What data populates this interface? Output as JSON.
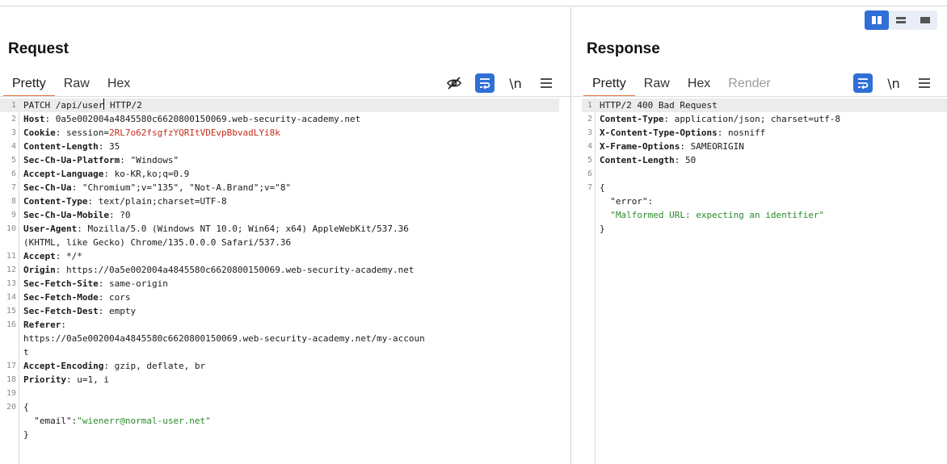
{
  "layout_toggle": {
    "icons": [
      "split-vertical-icon",
      "split-horizontal-icon",
      "single-pane-icon"
    ],
    "active": 0,
    "accent": "#2f6fd6"
  },
  "request": {
    "title": "Request",
    "tabs": [
      {
        "label": "Pretty",
        "active": true
      },
      {
        "label": "Raw",
        "active": false
      },
      {
        "label": "Hex",
        "active": false
      }
    ],
    "toolbar": {
      "hide_icon": "eye-off-icon",
      "wrap_icon": "word-wrap-icon",
      "newline_label": "\\n",
      "menu_icon": "hamburger-menu-icon"
    },
    "lines": [
      {
        "n": "1",
        "parts": [
          {
            "t": "PATCH /api/user",
            "c": "hv"
          },
          {
            "t": "CARET"
          },
          {
            "t": " HTTP/2",
            "c": "hv"
          }
        ],
        "cur": true
      },
      {
        "n": "2",
        "parts": [
          {
            "t": "Host",
            "c": "hk"
          },
          {
            "t": ": 0a5e002004a4845580c6620800150069.web-security-academy.net",
            "c": "hv"
          }
        ]
      },
      {
        "n": "3",
        "parts": [
          {
            "t": "Cookie",
            "c": "hk"
          },
          {
            "t": ": session=",
            "c": "hv"
          },
          {
            "t": "2RL7o62fsgfzYQRItVDEvpBbvadLYi8k",
            "c": "cookie-val"
          }
        ]
      },
      {
        "n": "4",
        "parts": [
          {
            "t": "Content-Length",
            "c": "hk"
          },
          {
            "t": ": 35",
            "c": "hv"
          }
        ]
      },
      {
        "n": "5",
        "parts": [
          {
            "t": "Sec-Ch-Ua-Platform",
            "c": "hk"
          },
          {
            "t": ": \"Windows\"",
            "c": "hv"
          }
        ]
      },
      {
        "n": "6",
        "parts": [
          {
            "t": "Accept-Language",
            "c": "hk"
          },
          {
            "t": ": ko-KR,ko;q=0.9",
            "c": "hv"
          }
        ]
      },
      {
        "n": "7",
        "parts": [
          {
            "t": "Sec-Ch-Ua",
            "c": "hk"
          },
          {
            "t": ": \"Chromium\";v=\"135\", \"Not-A.Brand\";v=\"8\"",
            "c": "hv"
          }
        ]
      },
      {
        "n": "8",
        "parts": [
          {
            "t": "Content-Type",
            "c": "hk"
          },
          {
            "t": ": text/plain;charset=UTF-8",
            "c": "hv"
          }
        ]
      },
      {
        "n": "9",
        "parts": [
          {
            "t": "Sec-Ch-Ua-Mobile",
            "c": "hk"
          },
          {
            "t": ": ?0",
            "c": "hv"
          }
        ]
      },
      {
        "n": "10",
        "parts": [
          {
            "t": "User-Agent",
            "c": "hk"
          },
          {
            "t": ": Mozilla/5.0 (Windows NT 10.0; Win64; x64) AppleWebKit/537.36",
            "c": "hv"
          }
        ]
      },
      {
        "n": "",
        "parts": [
          {
            "t": "(KHTML, like Gecko) Chrome/135.0.0.0 Safari/537.36",
            "c": "hv"
          }
        ]
      },
      {
        "n": "11",
        "parts": [
          {
            "t": "Accept",
            "c": "hk"
          },
          {
            "t": ": */*",
            "c": "hv"
          }
        ]
      },
      {
        "n": "12",
        "parts": [
          {
            "t": "Origin",
            "c": "hk"
          },
          {
            "t": ": https://0a5e002004a4845580c6620800150069.web-security-academy.net",
            "c": "hv"
          }
        ]
      },
      {
        "n": "13",
        "parts": [
          {
            "t": "Sec-Fetch-Site",
            "c": "hk"
          },
          {
            "t": ": same-origin",
            "c": "hv"
          }
        ]
      },
      {
        "n": "14",
        "parts": [
          {
            "t": "Sec-Fetch-Mode",
            "c": "hk"
          },
          {
            "t": ": cors",
            "c": "hv"
          }
        ]
      },
      {
        "n": "15",
        "parts": [
          {
            "t": "Sec-Fetch-Dest",
            "c": "hk"
          },
          {
            "t": ": empty",
            "c": "hv"
          }
        ]
      },
      {
        "n": "16",
        "parts": [
          {
            "t": "Referer",
            "c": "hk"
          },
          {
            "t": ":",
            "c": "hv"
          }
        ]
      },
      {
        "n": "",
        "parts": [
          {
            "t": "https://0a5e002004a4845580c6620800150069.web-security-academy.net/my-accoun",
            "c": "hv"
          }
        ]
      },
      {
        "n": "",
        "parts": [
          {
            "t": "t",
            "c": "hv"
          }
        ]
      },
      {
        "n": "17",
        "parts": [
          {
            "t": "Accept-Encoding",
            "c": "hk"
          },
          {
            "t": ": gzip, deflate, br",
            "c": "hv"
          }
        ]
      },
      {
        "n": "18",
        "parts": [
          {
            "t": "Priority",
            "c": "hk"
          },
          {
            "t": ": u=1, i",
            "c": "hv"
          }
        ]
      },
      {
        "n": "19",
        "parts": [
          {
            "t": "",
            "c": "hv"
          }
        ]
      },
      {
        "n": "20",
        "parts": [
          {
            "t": "{",
            "c": "hv"
          }
        ]
      },
      {
        "n": "",
        "parts": [
          {
            "t": "  \"email\"",
            "c": "jk"
          },
          {
            "t": ":",
            "c": "hv"
          },
          {
            "t": "\"wienerr@normal-user.net\"",
            "c": "js"
          }
        ]
      },
      {
        "n": "",
        "parts": [
          {
            "t": "}",
            "c": "hv"
          }
        ]
      }
    ]
  },
  "response": {
    "title": "Response",
    "tabs": [
      {
        "label": "Pretty",
        "active": true
      },
      {
        "label": "Raw",
        "active": false
      },
      {
        "label": "Hex",
        "active": false
      },
      {
        "label": "Render",
        "active": false,
        "disabled": true
      }
    ],
    "toolbar": {
      "wrap_icon": "word-wrap-icon",
      "newline_label": "\\n",
      "menu_icon": "hamburger-menu-icon"
    },
    "lines": [
      {
        "n": "1",
        "parts": [
          {
            "t": "HTTP/2 400 Bad Request",
            "c": "hv"
          }
        ],
        "cur": true
      },
      {
        "n": "2",
        "parts": [
          {
            "t": "Content-Type",
            "c": "hk"
          },
          {
            "t": ": application/json; charset=utf-8",
            "c": "hv"
          }
        ]
      },
      {
        "n": "3",
        "parts": [
          {
            "t": "X-Content-Type-Options",
            "c": "hk"
          },
          {
            "t": ": nosniff",
            "c": "hv"
          }
        ]
      },
      {
        "n": "4",
        "parts": [
          {
            "t": "X-Frame-Options",
            "c": "hk"
          },
          {
            "t": ": SAMEORIGIN",
            "c": "hv"
          }
        ]
      },
      {
        "n": "5",
        "parts": [
          {
            "t": "Content-Length",
            "c": "hk"
          },
          {
            "t": ": 50",
            "c": "hv"
          }
        ]
      },
      {
        "n": "6",
        "parts": [
          {
            "t": "",
            "c": "hv"
          }
        ]
      },
      {
        "n": "7",
        "parts": [
          {
            "t": "{",
            "c": "hv"
          }
        ]
      },
      {
        "n": "",
        "parts": [
          {
            "t": "  \"error\"",
            "c": "jk"
          },
          {
            "t": ":",
            "c": "hv"
          }
        ]
      },
      {
        "n": "",
        "parts": [
          {
            "t": "  \"Malformed URL: expecting an identifier\"",
            "c": "js"
          }
        ]
      },
      {
        "n": "",
        "parts": [
          {
            "t": "}",
            "c": "hv"
          }
        ]
      }
    ]
  }
}
